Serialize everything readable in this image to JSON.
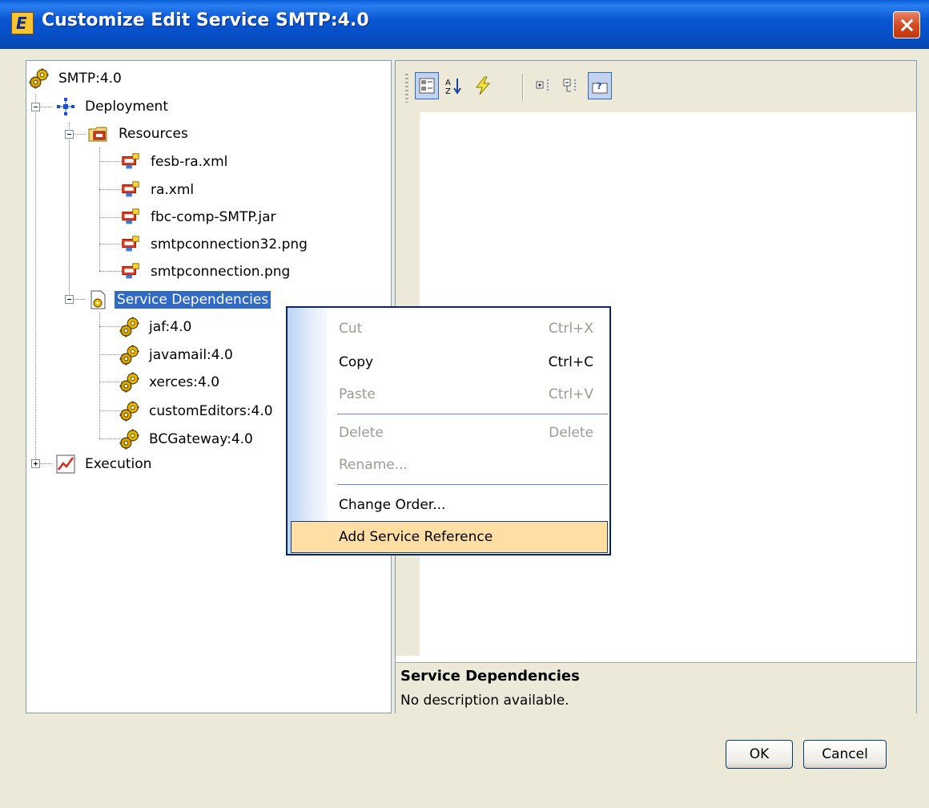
{
  "window": {
    "title": "Customize Edit Service SMTP:4.0",
    "app_icon": "e-logo-icon",
    "close_icon": "close-icon"
  },
  "tree": {
    "root": "SMTP:4.0",
    "deployment": "Deployment",
    "resources": "Resources",
    "resource_files": [
      "fesb-ra.xml",
      "ra.xml",
      "fbc-comp-SMTP.jar",
      "smtpconnection32.png",
      "smtpconnection.png"
    ],
    "service_dependencies": "Service Dependencies",
    "dependencies": [
      "jaf:4.0",
      "javamail:4.0",
      "xerces:4.0",
      "customEditors:4.0",
      "BCGateway:4.0"
    ],
    "execution": "Execution"
  },
  "context_menu": {
    "items": [
      {
        "label": "Cut",
        "shortcut": "Ctrl+X",
        "enabled": false
      },
      {
        "label": "Copy",
        "shortcut": "Ctrl+C",
        "enabled": true
      },
      {
        "label": "Paste",
        "shortcut": "Ctrl+V",
        "enabled": false
      },
      {
        "label": "Delete",
        "shortcut": "Delete",
        "enabled": false
      },
      {
        "label": "Rename...",
        "shortcut": "",
        "enabled": false
      },
      {
        "label": "Change Order...",
        "shortcut": "",
        "enabled": true
      },
      {
        "label": "Add Service Reference",
        "shortcut": "",
        "enabled": true,
        "highlighted": true
      }
    ]
  },
  "property_panel": {
    "toolbar_icons": [
      "categorized-icon",
      "alphabetical-icon",
      "events-icon",
      "expand-icon",
      "collapse-icon",
      "help-icon"
    ],
    "description_title": "Service Dependencies",
    "description_text": "No description available."
  },
  "buttons": {
    "ok": "OK",
    "cancel": "Cancel"
  },
  "colors": {
    "title_bar": "#0a57d4",
    "selection": "#316ac5",
    "menu_highlight": "#ffdea4",
    "dialog_bg": "#ece9d8"
  }
}
